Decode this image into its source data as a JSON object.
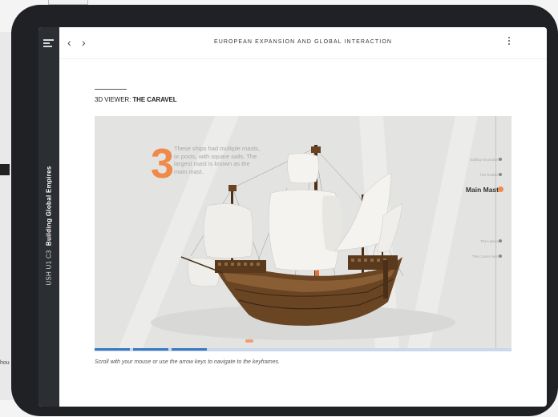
{
  "app": {
    "course_title": "EUROPEAN EXPANSION AND GLOBAL INTERACTION",
    "unit_code": "USH U1 C3",
    "unit_title": "Building Global Empires"
  },
  "nav": {
    "back_icon": "chevron-left-icon",
    "forward_icon": "chevron-right-icon",
    "menu_icon": "hamburger-menu-icon",
    "more_icon": "vertical-ellipsis-icon"
  },
  "section": {
    "label": "3D VIEWER:",
    "title": "THE CARAVEL"
  },
  "viewer": {
    "step_number": "3",
    "step_text": "These ships had multiple masts, or posts, with square sails. The largest mast is known as the main mast.",
    "keyframes": [
      {
        "label": "Sailing Innovation",
        "active": false
      },
      {
        "label": "The Rudder",
        "active": false
      },
      {
        "label": "Main Mast",
        "active": true
      },
      {
        "label": "The Lateen",
        "active": false
      },
      {
        "label": "The Crow's Nest",
        "active": false
      }
    ],
    "progress_segments": 3,
    "hint": "Scroll with your mouse or use the arrow keys to navigate to the keyframes."
  },
  "colors": {
    "accent": "#f08a4b",
    "progress": "#3a78c2",
    "sidebar": "#2b2e33",
    "viewer_bg": "#e3e3e2"
  },
  "edge": {
    "clipped_text": "hou"
  }
}
